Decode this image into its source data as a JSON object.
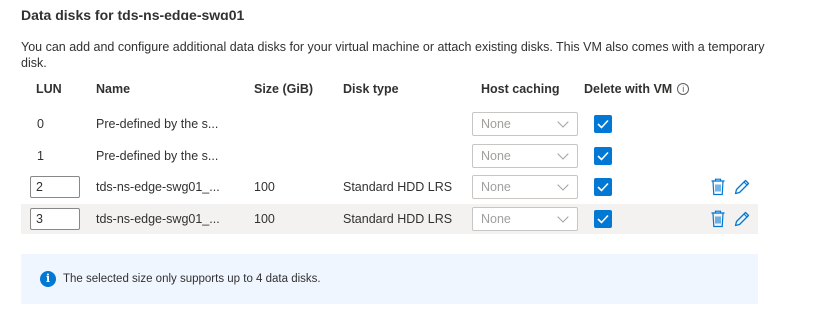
{
  "section": {
    "title": "Data disks for tds-ns-edge-swg01",
    "description": "You can add and configure additional data disks for your virtual machine or attach existing disks. This VM also comes with a temporary disk."
  },
  "table": {
    "headers": {
      "lun": "LUN",
      "name": "Name",
      "size": "Size (GiB)",
      "disk_type": "Disk type",
      "host_caching": "Host caching",
      "delete_with_vm": "Delete with VM"
    },
    "rows": [
      {
        "lun": "0",
        "name": "Pre-defined by the s...",
        "size": "",
        "disk_type": "",
        "host_caching": "None",
        "delete_with_vm": true
      },
      {
        "lun": "1",
        "name": "Pre-defined by the s...",
        "size": "",
        "disk_type": "",
        "host_caching": "None",
        "delete_with_vm": true
      },
      {
        "lun": "2",
        "name": "tds-ns-edge-swg01_...",
        "size": "100",
        "disk_type": "Standard HDD LRS",
        "host_caching": "None",
        "delete_with_vm": true
      },
      {
        "lun": "3",
        "name": "tds-ns-edge-swg01_...",
        "size": "100",
        "disk_type": "Standard HDD LRS",
        "host_caching": "None",
        "delete_with_vm": true
      }
    ]
  },
  "info_banner": {
    "text": "The selected size only supports up to 4 data disks."
  },
  "colors": {
    "accent": "#0078d4",
    "banner_bg": "#f0f6ff",
    "row_highlight": "#f3f2f1"
  }
}
